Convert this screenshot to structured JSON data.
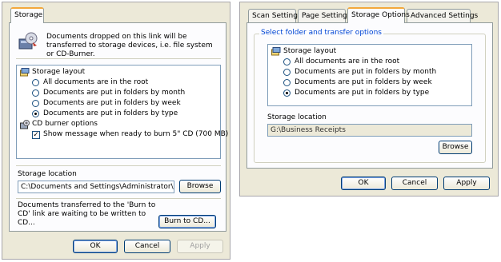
{
  "left_dialog": {
    "tab_label": "Storage",
    "description": "Documents dropped on this link will be transferred to storage devices, i.e. file system or CD-Burner.",
    "tree": {
      "layout_heading": "Storage layout",
      "options": [
        "All documents are in the root",
        "Documents are put in folders by month",
        "Documents are put in folders by week",
        "Documents are put in folders by type"
      ],
      "selected_index": 3,
      "cd_heading": "CD burner options",
      "cd_option": "Show message when ready to burn 5\" CD (700 MB)",
      "cd_checked": true
    },
    "location_label": "Storage location",
    "location_value": "C:\\Documents and Settings\\Administrator\\My Do",
    "browse_label": "Browse",
    "burn_message": "Documents transferred to the 'Burn to CD' link are waiting to be written to CD...",
    "burn_button": "Burn to CD...",
    "ok_label": "OK",
    "cancel_label": "Cancel",
    "apply_label": "Apply"
  },
  "right_dialog": {
    "tabs": [
      "Scan Settings",
      "Page Settings",
      "Storage Options",
      "Advanced Settings"
    ],
    "active_tab": 2,
    "group_title": "Select folder and transfer options",
    "tree": {
      "layout_heading": "Storage layout",
      "options": [
        "All documents are in the root",
        "Documents are put in folders by month",
        "Documents are put in folders by week",
        "Documents are put in folders by type"
      ],
      "selected_index": 3
    },
    "location_label": "Storage location",
    "location_value": "G:\\Business Receipts",
    "browse_label": "Browse",
    "ok_label": "OK",
    "cancel_label": "Cancel",
    "apply_label": "Apply"
  },
  "colors": {
    "dialog_bg": "#ece9d8",
    "page_bg": "#fcfcfe",
    "tab_highlight": "#f3a83c",
    "group_title": "#0046d5",
    "button_border": "#003c74"
  },
  "icons": [
    "storage-device-icon",
    "storage-layout-icon",
    "cd-burner-icon"
  ]
}
